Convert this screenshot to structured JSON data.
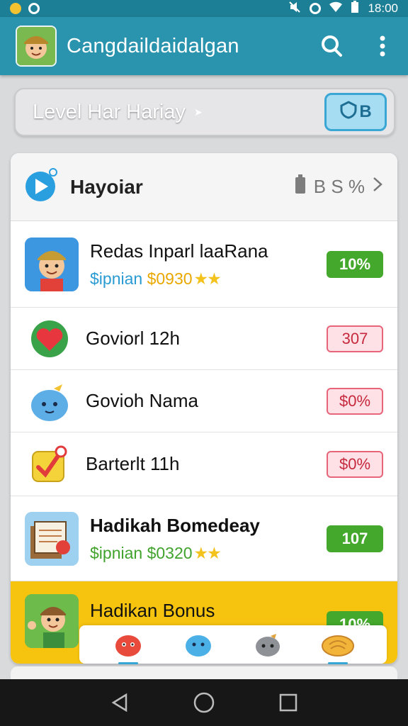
{
  "status_bar": {
    "time": "18:00"
  },
  "app_bar": {
    "title": "Cangdaildaidalgan"
  },
  "level_bar": {
    "label": "Level Har Hariay",
    "button_label": "B"
  },
  "card": {
    "title": "Hayoiar",
    "meta": "B S %",
    "rows": [
      {
        "name": "Redas Inparl laaRana",
        "sub_a": "$ipnian",
        "sub_b": "$0930",
        "stars": "★★",
        "badge": "10%",
        "badge_style": "green",
        "icon": "avatar-explorer-icon"
      },
      {
        "name": "Goviorl 12h",
        "badge": "307",
        "badge_style": "red",
        "icon": "heart-icon"
      },
      {
        "name": "Govioh Nama",
        "badge": "$0%",
        "badge_style": "red",
        "icon": "blue-creature-icon"
      },
      {
        "name": "Barterlt 11h",
        "badge": "$0%",
        "badge_style": "red",
        "icon": "checkmark-badge-icon"
      },
      {
        "name": "Hadikah Bomedeay",
        "sub_a": "$ipnian",
        "sub_b": "$0320",
        "stars": "★★",
        "badge": "107",
        "badge_style": "green",
        "icon": "notebook-icon"
      },
      {
        "name": "Hadikan Bonus",
        "badge": "10%",
        "badge_style": "green",
        "icon": "avatar-waving-icon"
      }
    ]
  },
  "tabs": [
    {
      "icon": "red-creature-icon",
      "active": true
    },
    {
      "icon": "blue-creature-icon",
      "active": false
    },
    {
      "icon": "gray-creature-icon",
      "active": false
    },
    {
      "icon": "bread-icon",
      "active": true
    }
  ],
  "colors": {
    "app_bar": "#2a93ad",
    "status_bar": "#1d7f95",
    "highlight_row": "#f6c40f",
    "badge_green": "#43a82b",
    "badge_red": "#e86479"
  }
}
